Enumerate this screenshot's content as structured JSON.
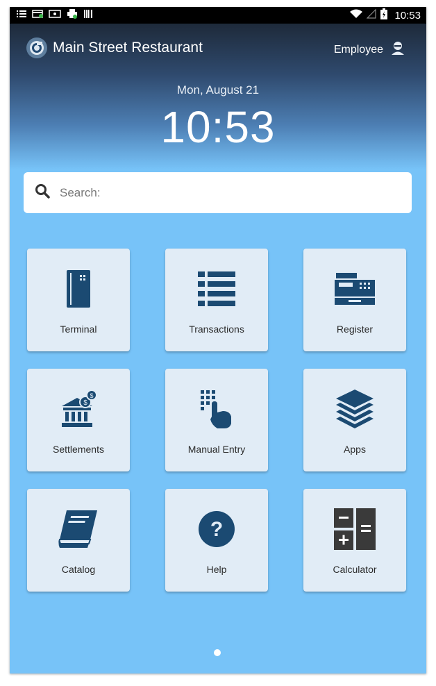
{
  "status_bar": {
    "time": "10:53"
  },
  "header": {
    "app_title": "Main Street Restaurant",
    "user_label": "Employee"
  },
  "clock": {
    "date": "Mon, August 21",
    "time": "10:53"
  },
  "search": {
    "placeholder": "Search:"
  },
  "tiles": [
    {
      "label": "Terminal",
      "icon": "card-terminal-icon"
    },
    {
      "label": "Transactions",
      "icon": "list-icon"
    },
    {
      "label": "Register",
      "icon": "register-icon"
    },
    {
      "label": "Settlements",
      "icon": "bank-icon"
    },
    {
      "label": "Manual Entry",
      "icon": "keypad-hand-icon"
    },
    {
      "label": "Apps",
      "icon": "layers-icon"
    },
    {
      "label": "Catalog",
      "icon": "book-icon"
    },
    {
      "label": "Help",
      "icon": "help-icon"
    },
    {
      "label": "Calculator",
      "icon": "calculator-icon"
    }
  ],
  "colors": {
    "accent": "#1b4a72",
    "background": "#77c3f8",
    "tile": "#e1ecf6"
  }
}
